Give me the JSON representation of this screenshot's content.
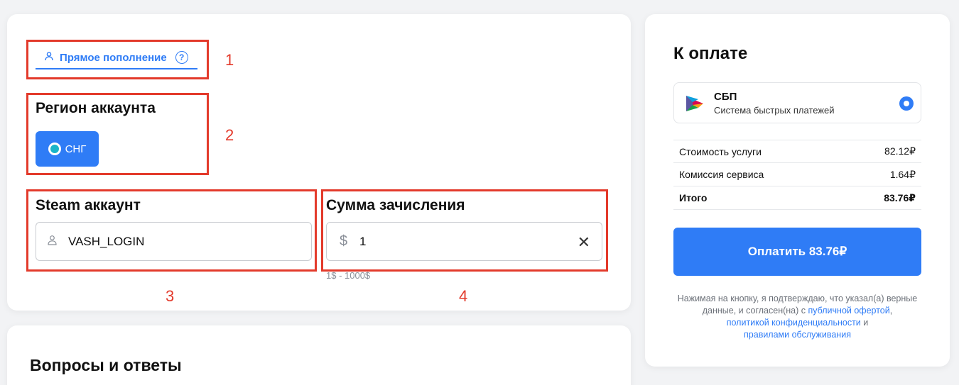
{
  "tab": {
    "label": "Прямое пополнение",
    "help_glyph": "?"
  },
  "region": {
    "heading": "Регион аккаунта",
    "button_label": "СНГ"
  },
  "steam": {
    "heading": "Steam аккаунт",
    "value": "VASH_LOGIN"
  },
  "sum": {
    "heading": "Сумма зачисления",
    "currency_symbol": "$",
    "value": "1",
    "hint": "1$ - 1000$",
    "clear_glyph": "✕"
  },
  "annotations": [
    "1",
    "2",
    "3",
    "4"
  ],
  "faq": {
    "heading": "Вопросы и ответы"
  },
  "payment": {
    "title": "К оплате",
    "method": {
      "name": "СБП",
      "description": "Система быстрых платежей"
    },
    "rows": [
      {
        "label": "Стоимость услуги",
        "value": "82.12₽"
      },
      {
        "label": "Комиссия сервиса",
        "value": "1.64₽"
      },
      {
        "label": "Итого",
        "value": "83.76₽"
      }
    ],
    "pay_button": "Оплатить 83.76₽",
    "legal": {
      "prefix": "Нажимая на кнопку, я подтверждаю, что указал(а) верные данные, и согласен(на) с ",
      "link_offer": "публичной офертой",
      "sep": ", ",
      "link_privacy": "политикой конфиденциальности",
      "and": " и ",
      "link_rules": "правилами обслуживания"
    }
  },
  "colors": {
    "accent": "#2f7cf6",
    "annotation": "#e33a2b",
    "background": "#f2f3f5"
  },
  "icons": [
    "user-icon",
    "help-icon",
    "globe-icon",
    "dollar-icon",
    "close-icon",
    "sbp-logo-icon"
  ]
}
